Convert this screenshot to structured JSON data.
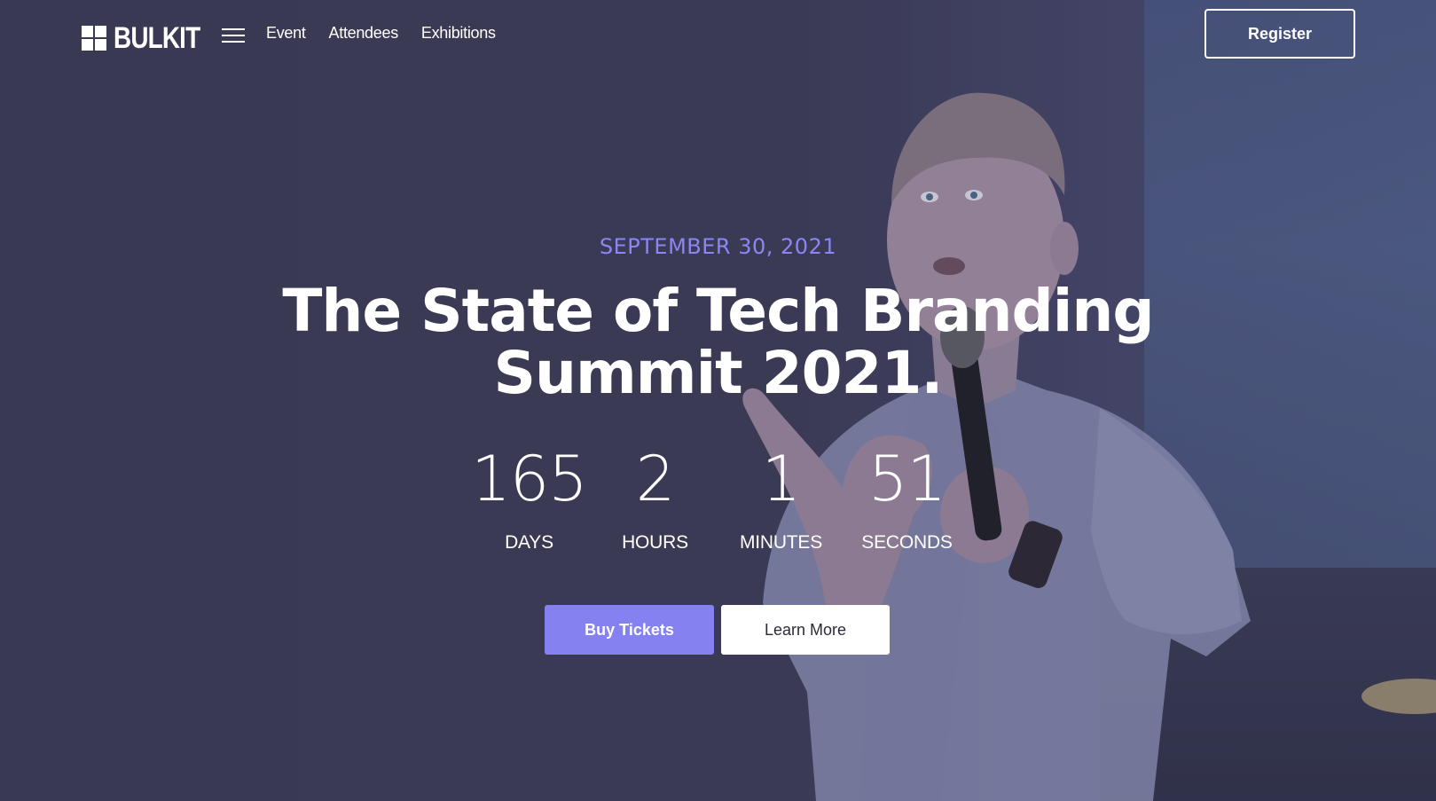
{
  "brand": {
    "name": "BULKIT",
    "logo_icon": "four-squares-logo-icon"
  },
  "nav": {
    "menu_icon": "hamburger-menu-icon",
    "links": [
      {
        "label": "Event"
      },
      {
        "label": "Attendees"
      },
      {
        "label": "Exhibitions"
      }
    ],
    "register_label": "Register"
  },
  "hero": {
    "date": "SEPTEMBER 30, 2021",
    "title": "The State of Tech Branding Summit 2021.",
    "countdown": [
      {
        "value": "165",
        "label": "DAYS"
      },
      {
        "value": "2",
        "label": "HOURS"
      },
      {
        "value": "1",
        "label": "MINUTES"
      },
      {
        "value": "51",
        "label": "SECONDS"
      }
    ],
    "buttons": {
      "primary_label": "Buy Tickets",
      "secondary_label": "Learn More"
    },
    "background_image": "speaker-holding-microphone-photo"
  },
  "colors": {
    "background": "#3b3b55",
    "accent": "#8581f0",
    "date_text": "#8b86f2",
    "text": "#ffffff"
  }
}
